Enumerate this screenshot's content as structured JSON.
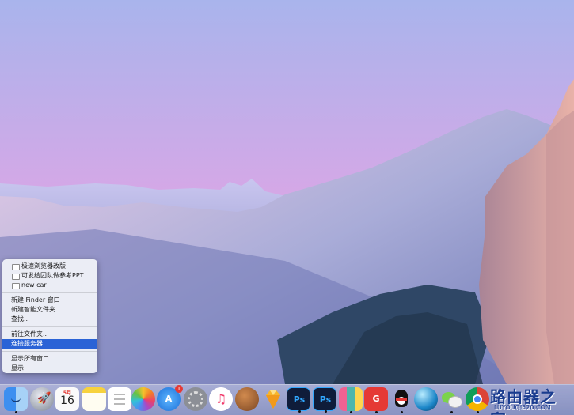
{
  "context_menu": {
    "recent_folders": [
      "极速浏览器改版",
      "可发给团队做参考PPT",
      "new car"
    ],
    "new_finder_window": "新建 Finder 窗口",
    "new_smart_folder": "新建智能文件夹",
    "find": "查找...",
    "go_to_folder": "前往文件夹...",
    "connect_to_server": "连接服务器...",
    "show_all_windows": "显示所有窗口",
    "show": "显示"
  },
  "dock": {
    "calendar_month": "5月",
    "calendar_day": "16",
    "app_store_badge": "1",
    "ps_label": "Ps"
  },
  "watermark": {
    "text": "路由器之家",
    "url": "LUYOUQI520.COM"
  },
  "colors": {
    "menu_highlight": "#2a63d6",
    "sky_top": "#a9b4ec",
    "sky_pink": "#e8a6e2"
  }
}
